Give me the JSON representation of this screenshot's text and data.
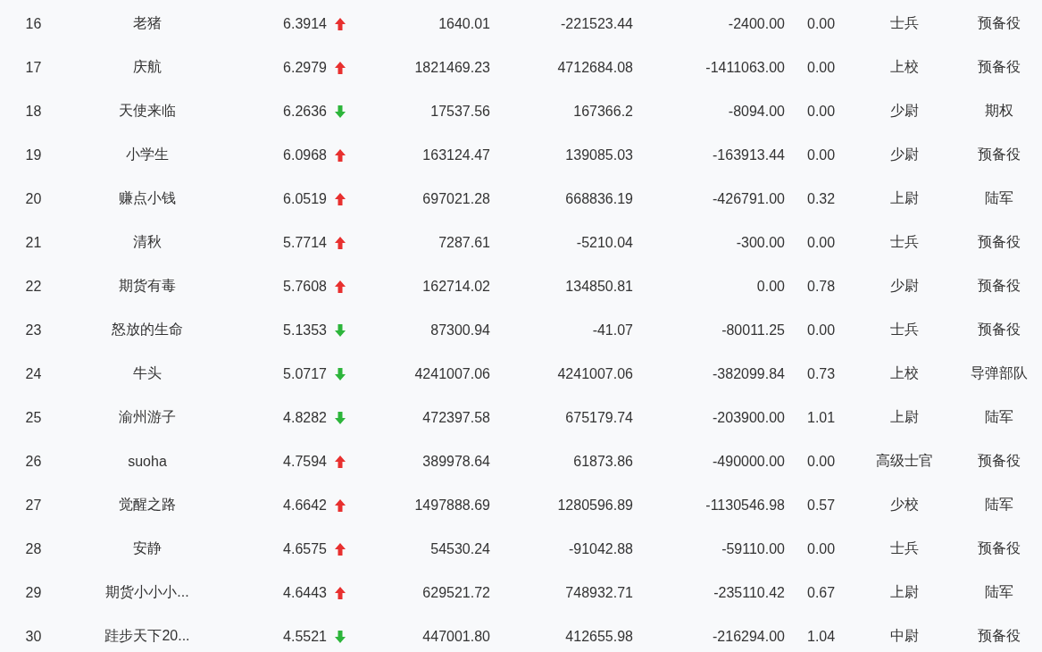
{
  "rows": [
    {
      "rank": "16",
      "name": "老猪",
      "score": "6.3914",
      "rising": true,
      "column_4": "1640.01",
      "column_5": "-221523.44",
      "column_6": "-2400.00",
      "column_7": "0.00",
      "column_8": "士兵",
      "column_9": "预备役"
    },
    {
      "rank": "17",
      "name": "庆航",
      "score": "6.2979",
      "rising": true,
      "column_4": "1821469.23",
      "column_5": "4712684.08",
      "column_6": "-1411063.00",
      "column_7": "0.00",
      "column_8": "上校",
      "column_9": "预备役"
    },
    {
      "rank": "18",
      "name": "天使来临",
      "score": "6.2636",
      "rising": false,
      "column_4": "17537.56",
      "column_5": "167366.2",
      "column_6": "-8094.00",
      "column_7": "0.00",
      "column_8": "少尉",
      "column_9": "期权"
    },
    {
      "rank": "19",
      "name": "小学生",
      "score": "6.0968",
      "rising": true,
      "column_4": "163124.47",
      "column_5": "139085.03",
      "column_6": "-163913.44",
      "column_7": "0.00",
      "column_8": "少尉",
      "column_9": "预备役"
    },
    {
      "rank": "20",
      "name": "赚点小钱",
      "score": "6.0519",
      "rising": true,
      "column_4": "697021.28",
      "column_5": "668836.19",
      "column_6": "-426791.00",
      "column_7": "0.32",
      "column_8": "上尉",
      "column_9": "陆军"
    },
    {
      "rank": "21",
      "name": "清秋",
      "score": "5.7714",
      "rising": true,
      "column_4": "7287.61",
      "column_5": "-5210.04",
      "column_6": "-300.00",
      "column_7": "0.00",
      "column_8": "士兵",
      "column_9": "预备役"
    },
    {
      "rank": "22",
      "name": "期货有毒",
      "score": "5.7608",
      "rising": true,
      "column_4": "162714.02",
      "column_5": "134850.81",
      "column_6": "0.00",
      "column_7": "0.78",
      "column_8": "少尉",
      "column_9": "预备役"
    },
    {
      "rank": "23",
      "name": "怒放的生命",
      "score": "5.1353",
      "rising": false,
      "column_4": "87300.94",
      "column_5": "-41.07",
      "column_6": "-80011.25",
      "column_7": "0.00",
      "column_8": "士兵",
      "column_9": "预备役"
    },
    {
      "rank": "24",
      "name": "牛头",
      "score": "5.0717",
      "rising": false,
      "column_4": "4241007.06",
      "column_5": "4241007.06",
      "column_6": "-382099.84",
      "column_7": "0.73",
      "column_8": "上校",
      "column_9": "导弹部队"
    },
    {
      "rank": "25",
      "name": "渝州游子",
      "score": "4.8282",
      "rising": false,
      "column_4": "472397.58",
      "column_5": "675179.74",
      "column_6": "-203900.00",
      "column_7": "1.01",
      "column_8": "上尉",
      "column_9": "陆军"
    },
    {
      "rank": "26",
      "name": "suoha",
      "score": "4.7594",
      "rising": true,
      "column_4": "389978.64",
      "column_5": "61873.86",
      "column_6": "-490000.00",
      "column_7": "0.00",
      "column_8": "高级士官",
      "column_9": "预备役"
    },
    {
      "rank": "27",
      "name": "觉醒之路",
      "score": "4.6642",
      "rising": true,
      "column_4": "1497888.69",
      "column_5": "1280596.89",
      "column_6": "-1130546.98",
      "column_7": "0.57",
      "column_8": "少校",
      "column_9": "陆军"
    },
    {
      "rank": "28",
      "name": "安静",
      "score": "4.6575",
      "rising": true,
      "column_4": "54530.24",
      "column_5": "-91042.88",
      "column_6": "-59110.00",
      "column_7": "0.00",
      "column_8": "士兵",
      "column_9": "预备役"
    },
    {
      "rank": "29",
      "name": "期货小小小...",
      "score": "4.6443",
      "rising": true,
      "column_4": "629521.72",
      "column_5": "748932.71",
      "column_6": "-235110.42",
      "column_7": "0.67",
      "column_8": "上尉",
      "column_9": "陆军"
    },
    {
      "rank": "30",
      "name": "跬步天下20...",
      "score": "4.5521",
      "rising": false,
      "column_4": "447001.80",
      "column_5": "412655.98",
      "column_6": "-216294.00",
      "column_7": "1.04",
      "column_8": "中尉",
      "column_9": "预备役"
    }
  ]
}
